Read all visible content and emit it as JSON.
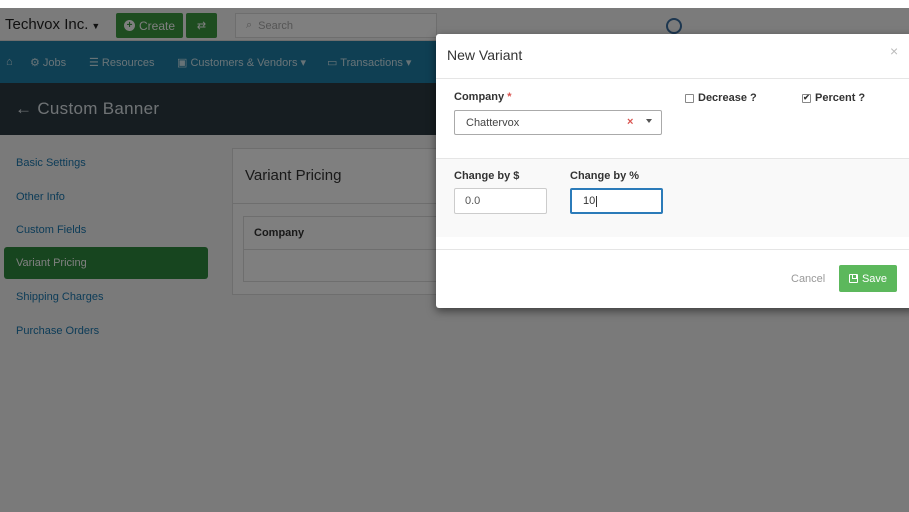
{
  "topbar": {
    "brand": "Techvox Inc.",
    "create_label": "Create",
    "search_placeholder": "Search"
  },
  "nav": {
    "items": [
      "Jobs",
      "Resources",
      "Customers & Vendors",
      "Transactions"
    ]
  },
  "banner": {
    "title": "Custom Banner"
  },
  "sidebar": {
    "items": [
      {
        "label": "Basic Settings"
      },
      {
        "label": "Other Info"
      },
      {
        "label": "Custom Fields"
      },
      {
        "label": "Variant Pricing"
      },
      {
        "label": "Shipping Charges"
      },
      {
        "label": "Purchase Orders"
      }
    ],
    "active_index": 3
  },
  "panel": {
    "title": "Variant Pricing",
    "column_header": "Company"
  },
  "modal": {
    "title": "New Variant",
    "close": "×",
    "company_label": "Company",
    "required_mark": "*",
    "company_value": "Chattervox",
    "clear_icon": "×",
    "decrease_label": "Decrease ?",
    "decrease_checked": false,
    "percent_label": "Percent ?",
    "percent_checked": true,
    "change_dollar_label": "Change by $",
    "change_dollar_value": "0.0",
    "change_pct_label": "Change by %",
    "change_pct_value": "10",
    "cancel_label": "Cancel",
    "save_label": "Save"
  },
  "colors": {
    "primary_green": "#3c9a41",
    "nav_blue": "#1f7fa6",
    "banner_dark": "#2d3a43",
    "save_green": "#5cb85c",
    "focus_blue": "#2b7bb9"
  }
}
